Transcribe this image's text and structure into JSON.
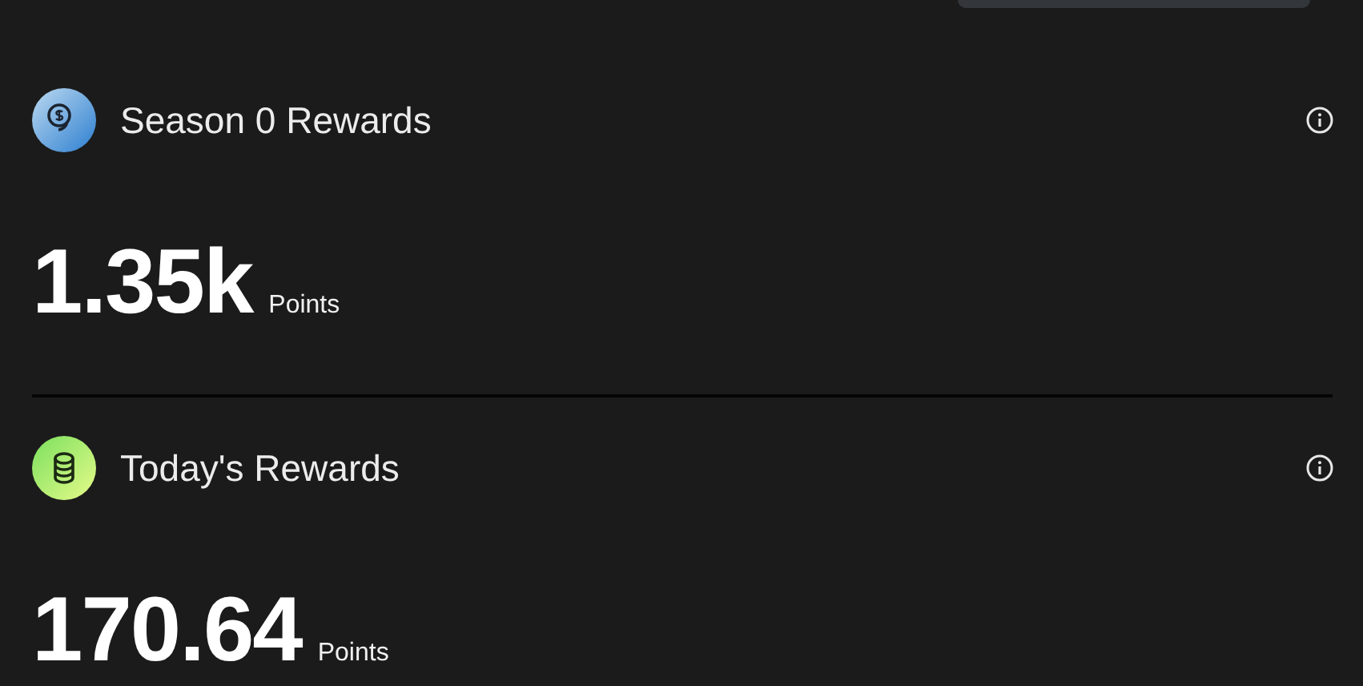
{
  "sections": [
    {
      "kind": "coins",
      "title": "Season 0 Rewards",
      "value": "1.35k",
      "unit": "Points"
    },
    {
      "kind": "stack",
      "title": "Today's Rewards",
      "value": "170.64",
      "unit": "Points"
    }
  ]
}
